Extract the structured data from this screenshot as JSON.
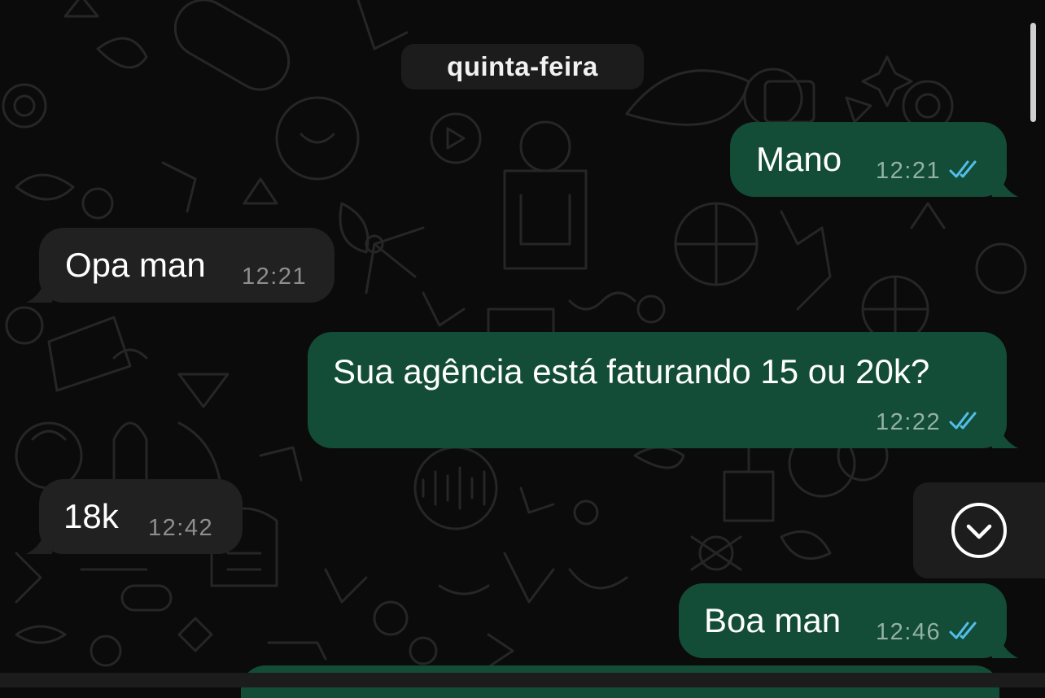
{
  "chat": {
    "date_separator": "quinta-feira",
    "messages": [
      {
        "direction": "outgoing",
        "text": "Mano",
        "time": "12:21",
        "status": "read"
      },
      {
        "direction": "incoming",
        "text": "Opa man",
        "time": "12:21"
      },
      {
        "direction": "outgoing",
        "text": "Sua agência está faturando 15 ou 20k?",
        "time": "12:22",
        "status": "read"
      },
      {
        "direction": "incoming",
        "text": "18k",
        "time": "12:42"
      },
      {
        "direction": "outgoing",
        "text": "Boa man",
        "time": "12:46",
        "status": "read"
      }
    ]
  },
  "controls": {
    "scroll_to_bottom_icon": "chevron-down-circle-icon",
    "read_receipt_icon": "double-check-icon"
  },
  "colors": {
    "background": "#0b0b0b",
    "outgoing_bubble": "#134d37",
    "incoming_bubble": "#212121",
    "read_receipt": "#53bdeb",
    "wallpaper_doodles": "#262626"
  }
}
